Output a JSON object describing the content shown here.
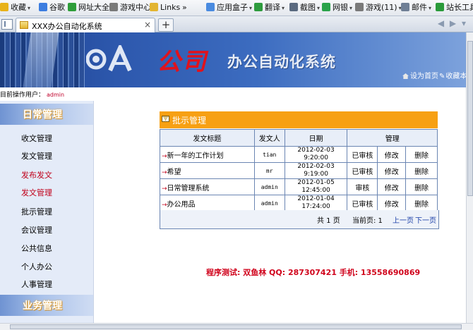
{
  "bookmarks": [
    {
      "label": "收藏",
      "icon": "star-icon",
      "color": "#e8b21a",
      "dropdown": true
    },
    {
      "label": "谷歌",
      "icon": "google-icon",
      "color": "#3c7de0"
    },
    {
      "label": "网址大全",
      "icon": "web-icon",
      "color": "#2f9e3a"
    },
    {
      "label": "游戏中心",
      "icon": "gamepad-icon",
      "color": "#7a7a7a"
    },
    {
      "label": "Links",
      "icon": "folder-icon",
      "color": "#e3b531"
    },
    {
      "label": "»",
      "icon": "",
      "color": ""
    },
    {
      "label": "应用盒子",
      "icon": "app-box-icon",
      "color": "#4a8be0",
      "dropdown": true
    },
    {
      "label": "翻译",
      "icon": "translate-icon",
      "color": "#2e9b3e",
      "dropdown": true
    },
    {
      "label": "截图",
      "icon": "scissors-icon",
      "color": "#5a6a80",
      "dropdown": true
    },
    {
      "label": "网银",
      "icon": "bank-icon",
      "color": "#2aa34a",
      "dropdown": true
    },
    {
      "label": "游戏(11)",
      "icon": "game-icon",
      "color": "#7a7a7a",
      "dropdown": true
    },
    {
      "label": "邮件",
      "icon": "mail-icon",
      "color": "#6f7f96",
      "dropdown": true
    },
    {
      "label": "站长工具",
      "icon": "tools-icon",
      "color": "#2a9a3a"
    }
  ],
  "tab": {
    "title": "XXX办公自动化系统",
    "close": "×",
    "new_tab": "+"
  },
  "banner": {
    "logo_text": "OA",
    "company": "公司",
    "system_title": "办公自动化系统",
    "home_link": "设为首页",
    "favorite_link": "收藏本"
  },
  "operator": {
    "label": "目前操作用户：",
    "user": "admin"
  },
  "sidebar": {
    "section1": "日常管理",
    "items": [
      {
        "label": "收文管理",
        "red": false
      },
      {
        "label": "发文管理",
        "red": false
      },
      {
        "label": "发布发文",
        "red": true
      },
      {
        "label": "发文管理",
        "red": true
      },
      {
        "label": "批示管理",
        "red": false
      },
      {
        "label": "会议管理",
        "red": false
      },
      {
        "label": "公共信息",
        "red": false
      },
      {
        "label": "个人办公",
        "red": false
      },
      {
        "label": "人事管理",
        "red": false
      }
    ],
    "section2": "业务管理"
  },
  "panel": {
    "title": "批示管理",
    "columns": [
      "发文标题",
      "发文人",
      "日期",
      "管理"
    ],
    "rows": [
      {
        "title": "新一年的工作计划",
        "author": "tian",
        "date": "2012-02-03 9:20:00",
        "status": "已审核",
        "edit": "修改",
        "delete": "删除"
      },
      {
        "title": "希望",
        "author": "mr",
        "date": "2012-02-03 9:19:00",
        "status": "已审核",
        "edit": "修改",
        "delete": "删除"
      },
      {
        "title": "日常管理系统",
        "author": "admin",
        "date": "2012-01-05 12:45:00",
        "status": "审核",
        "edit": "修改",
        "delete": "删除"
      },
      {
        "title": "办公用品",
        "author": "admin",
        "date": "2012-01-04 17:24:00",
        "status": "已审核",
        "edit": "修改",
        "delete": "删除"
      }
    ],
    "pager": {
      "total": "共 1 页",
      "current": "当前页: 1",
      "prev": "上一页",
      "next": "下一页"
    }
  },
  "footer_credit": "程序测试: 双鱼林    QQ: 287307421    手机: 13558690869",
  "colors": {
    "accent_orange": "#f7a013",
    "banner_blue": "#2d58ad",
    "company_red": "#e1121c",
    "link_blue": "#1a3fa8"
  }
}
